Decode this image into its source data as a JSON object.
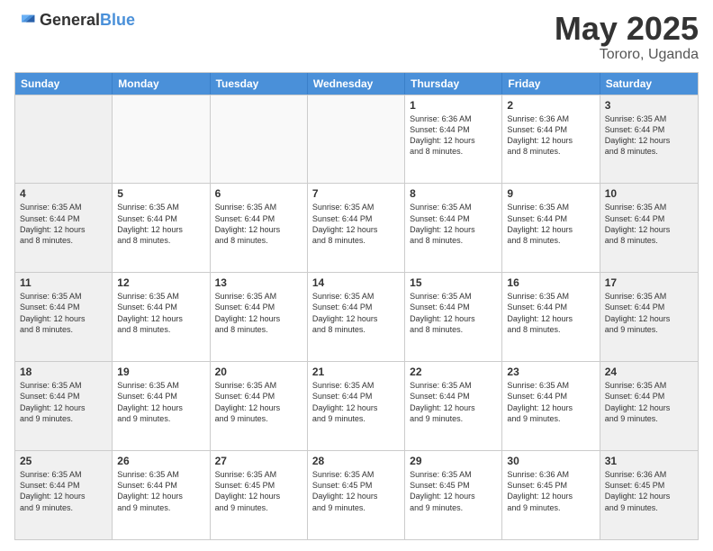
{
  "logo": {
    "general": "General",
    "blue": "Blue"
  },
  "title": "May 2025",
  "subtitle": "Tororo, Uganda",
  "days": [
    "Sunday",
    "Monday",
    "Tuesday",
    "Wednesday",
    "Thursday",
    "Friday",
    "Saturday"
  ],
  "weeks": [
    [
      {
        "day": "",
        "info": ""
      },
      {
        "day": "",
        "info": ""
      },
      {
        "day": "",
        "info": ""
      },
      {
        "day": "",
        "info": ""
      },
      {
        "day": "1",
        "info": "Sunrise: 6:36 AM\nSunset: 6:44 PM\nDaylight: 12 hours\nand 8 minutes."
      },
      {
        "day": "2",
        "info": "Sunrise: 6:36 AM\nSunset: 6:44 PM\nDaylight: 12 hours\nand 8 minutes."
      },
      {
        "day": "3",
        "info": "Sunrise: 6:35 AM\nSunset: 6:44 PM\nDaylight: 12 hours\nand 8 minutes."
      }
    ],
    [
      {
        "day": "4",
        "info": "Sunrise: 6:35 AM\nSunset: 6:44 PM\nDaylight: 12 hours\nand 8 minutes."
      },
      {
        "day": "5",
        "info": "Sunrise: 6:35 AM\nSunset: 6:44 PM\nDaylight: 12 hours\nand 8 minutes."
      },
      {
        "day": "6",
        "info": "Sunrise: 6:35 AM\nSunset: 6:44 PM\nDaylight: 12 hours\nand 8 minutes."
      },
      {
        "day": "7",
        "info": "Sunrise: 6:35 AM\nSunset: 6:44 PM\nDaylight: 12 hours\nand 8 minutes."
      },
      {
        "day": "8",
        "info": "Sunrise: 6:35 AM\nSunset: 6:44 PM\nDaylight: 12 hours\nand 8 minutes."
      },
      {
        "day": "9",
        "info": "Sunrise: 6:35 AM\nSunset: 6:44 PM\nDaylight: 12 hours\nand 8 minutes."
      },
      {
        "day": "10",
        "info": "Sunrise: 6:35 AM\nSunset: 6:44 PM\nDaylight: 12 hours\nand 8 minutes."
      }
    ],
    [
      {
        "day": "11",
        "info": "Sunrise: 6:35 AM\nSunset: 6:44 PM\nDaylight: 12 hours\nand 8 minutes."
      },
      {
        "day": "12",
        "info": "Sunrise: 6:35 AM\nSunset: 6:44 PM\nDaylight: 12 hours\nand 8 minutes."
      },
      {
        "day": "13",
        "info": "Sunrise: 6:35 AM\nSunset: 6:44 PM\nDaylight: 12 hours\nand 8 minutes."
      },
      {
        "day": "14",
        "info": "Sunrise: 6:35 AM\nSunset: 6:44 PM\nDaylight: 12 hours\nand 8 minutes."
      },
      {
        "day": "15",
        "info": "Sunrise: 6:35 AM\nSunset: 6:44 PM\nDaylight: 12 hours\nand 8 minutes."
      },
      {
        "day": "16",
        "info": "Sunrise: 6:35 AM\nSunset: 6:44 PM\nDaylight: 12 hours\nand 8 minutes."
      },
      {
        "day": "17",
        "info": "Sunrise: 6:35 AM\nSunset: 6:44 PM\nDaylight: 12 hours\nand 9 minutes."
      }
    ],
    [
      {
        "day": "18",
        "info": "Sunrise: 6:35 AM\nSunset: 6:44 PM\nDaylight: 12 hours\nand 9 minutes."
      },
      {
        "day": "19",
        "info": "Sunrise: 6:35 AM\nSunset: 6:44 PM\nDaylight: 12 hours\nand 9 minutes."
      },
      {
        "day": "20",
        "info": "Sunrise: 6:35 AM\nSunset: 6:44 PM\nDaylight: 12 hours\nand 9 minutes."
      },
      {
        "day": "21",
        "info": "Sunrise: 6:35 AM\nSunset: 6:44 PM\nDaylight: 12 hours\nand 9 minutes."
      },
      {
        "day": "22",
        "info": "Sunrise: 6:35 AM\nSunset: 6:44 PM\nDaylight: 12 hours\nand 9 minutes."
      },
      {
        "day": "23",
        "info": "Sunrise: 6:35 AM\nSunset: 6:44 PM\nDaylight: 12 hours\nand 9 minutes."
      },
      {
        "day": "24",
        "info": "Sunrise: 6:35 AM\nSunset: 6:44 PM\nDaylight: 12 hours\nand 9 minutes."
      }
    ],
    [
      {
        "day": "25",
        "info": "Sunrise: 6:35 AM\nSunset: 6:44 PM\nDaylight: 12 hours\nand 9 minutes."
      },
      {
        "day": "26",
        "info": "Sunrise: 6:35 AM\nSunset: 6:44 PM\nDaylight: 12 hours\nand 9 minutes."
      },
      {
        "day": "27",
        "info": "Sunrise: 6:35 AM\nSunset: 6:45 PM\nDaylight: 12 hours\nand 9 minutes."
      },
      {
        "day": "28",
        "info": "Sunrise: 6:35 AM\nSunset: 6:45 PM\nDaylight: 12 hours\nand 9 minutes."
      },
      {
        "day": "29",
        "info": "Sunrise: 6:35 AM\nSunset: 6:45 PM\nDaylight: 12 hours\nand 9 minutes."
      },
      {
        "day": "30",
        "info": "Sunrise: 6:36 AM\nSunset: 6:45 PM\nDaylight: 12 hours\nand 9 minutes."
      },
      {
        "day": "31",
        "info": "Sunrise: 6:36 AM\nSunset: 6:45 PM\nDaylight: 12 hours\nand 9 minutes."
      }
    ]
  ]
}
